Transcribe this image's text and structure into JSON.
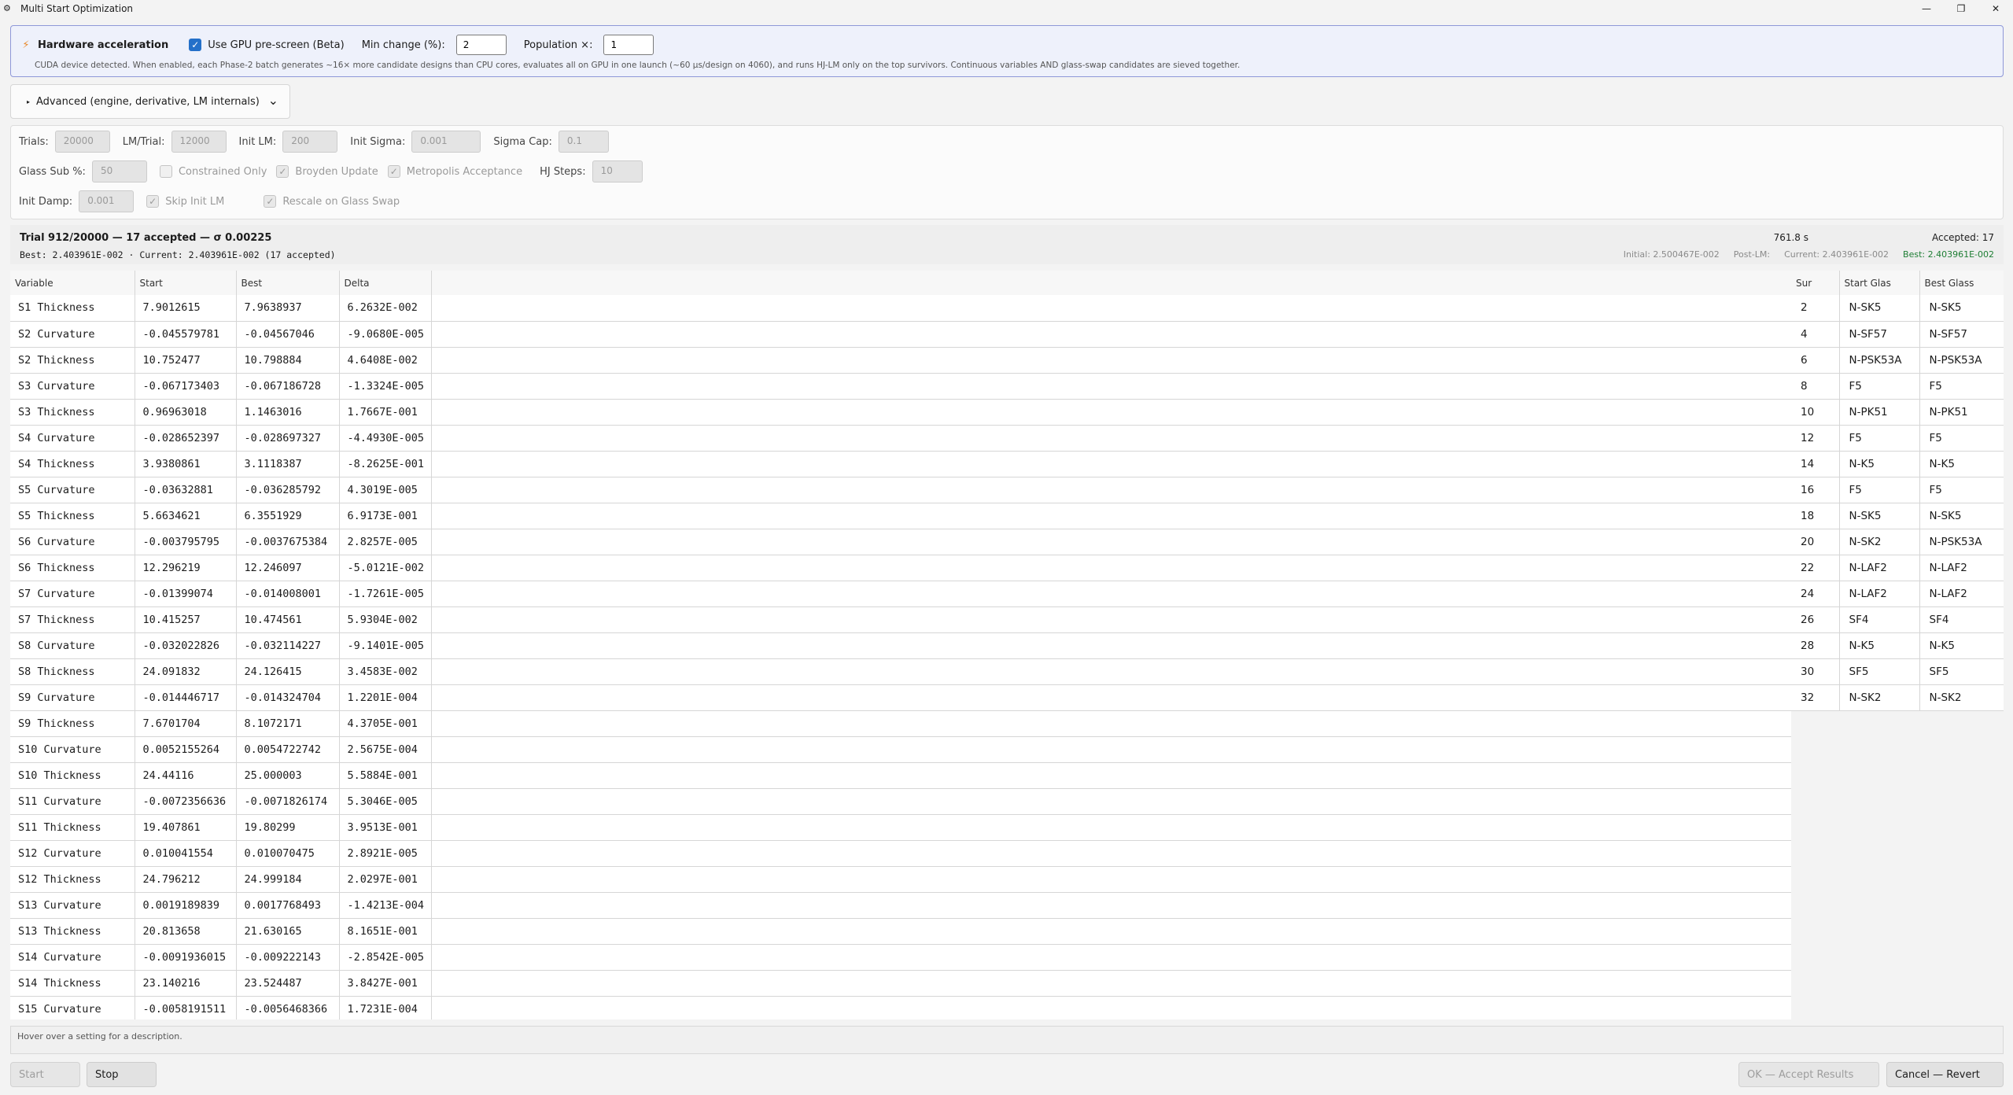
{
  "window": {
    "title": "Multi Start Optimization",
    "controls": [
      "—",
      "❐",
      "✕"
    ]
  },
  "hardware": {
    "title": "Hardware acceleration",
    "gpu_label": "Use GPU pre-screen (Beta)",
    "gpu_checked": true,
    "min_change_label": "Min change (%):",
    "min_change_value": "2",
    "population_label": "Population ×:",
    "population_value": "1",
    "note": "CUDA device detected. When enabled, each Phase-2 batch generates ~16× more candidate designs than CPU cores, evaluates all on GPU in one launch (~60 µs/design on 4060), and runs HJ-LM only on the top survivors. Continuous variables AND glass-swap candidates are sieved together."
  },
  "advanced": {
    "toggle_label": "Advanced (engine, derivative, LM internals)",
    "trials_label": "Trials:",
    "trials": "20000",
    "lm_trial_label": "LM/Trial:",
    "lm_trial": "12000",
    "init_lm_label": "Init LM:",
    "init_lm": "200",
    "init_sigma_label": "Init Sigma:",
    "init_sigma": "0.001",
    "sigma_cap_label": "Sigma Cap:",
    "sigma_cap": "0.1",
    "glass_sub_label": "Glass Sub %:",
    "glass_sub": "50",
    "constrained_only": "Constrained Only",
    "broyden_update": "Broyden Update",
    "metropolis": "Metropolis Acceptance",
    "hj_steps_label": "HJ Steps:",
    "hj_steps": "10",
    "init_damp_label": "Init Damp:",
    "init_damp": "0.001",
    "skip_init_lm": "Skip Init LM",
    "rescale_glass_swap": "Rescale on Glass Swap"
  },
  "status": {
    "title": "Trial 912/20000 — 17 accepted — σ 0.00225",
    "subtitle": "Best: 2.403961E-002  ·  Current: 2.403961E-002  (17 accepted)",
    "time": "761.8 s",
    "accepted": "Accepted: 17",
    "initial": "Initial: 2.500467E-002",
    "post_lm": "Post-LM:",
    "current": "Current: 2.403961E-002",
    "best": "Best: 2.403961E-002"
  },
  "variables": {
    "headers": [
      "Variable",
      "Start",
      "Best",
      "Delta"
    ],
    "rows": [
      [
        "S1 Thickness",
        "7.9012615",
        "7.9638937",
        "6.2632E-002"
      ],
      [
        "S2 Curvature",
        "-0.045579781",
        "-0.04567046",
        "-9.0680E-005"
      ],
      [
        "S2 Thickness",
        "10.752477",
        "10.798884",
        "4.6408E-002"
      ],
      [
        "S3 Curvature",
        "-0.067173403",
        "-0.067186728",
        "-1.3324E-005"
      ],
      [
        "S3 Thickness",
        "0.96963018",
        "1.1463016",
        "1.7667E-001"
      ],
      [
        "S4 Curvature",
        "-0.028652397",
        "-0.028697327",
        "-4.4930E-005"
      ],
      [
        "S4 Thickness",
        "3.9380861",
        "3.1118387",
        "-8.2625E-001"
      ],
      [
        "S5 Curvature",
        "-0.03632881",
        "-0.036285792",
        "4.3019E-005"
      ],
      [
        "S5 Thickness",
        "5.6634621",
        "6.3551929",
        "6.9173E-001"
      ],
      [
        "S6 Curvature",
        "-0.003795795",
        "-0.0037675384",
        "2.8257E-005"
      ],
      [
        "S6 Thickness",
        "12.296219",
        "12.246097",
        "-5.0121E-002"
      ],
      [
        "S7 Curvature",
        "-0.01399074",
        "-0.014008001",
        "-1.7261E-005"
      ],
      [
        "S7 Thickness",
        "10.415257",
        "10.474561",
        "5.9304E-002"
      ],
      [
        "S8 Curvature",
        "-0.032022826",
        "-0.032114227",
        "-9.1401E-005"
      ],
      [
        "S8 Thickness",
        "24.091832",
        "24.126415",
        "3.4583E-002"
      ],
      [
        "S9 Curvature",
        "-0.014446717",
        "-0.014324704",
        "1.2201E-004"
      ],
      [
        "S9 Thickness",
        "7.6701704",
        "8.1072171",
        "4.3705E-001"
      ],
      [
        "S10 Curvature",
        "0.0052155264",
        "0.0054722742",
        "2.5675E-004"
      ],
      [
        "S10 Thickness",
        "24.44116",
        "25.000003",
        "5.5884E-001"
      ],
      [
        "S11 Curvature",
        "-0.0072356636",
        "-0.0071826174",
        "5.3046E-005"
      ],
      [
        "S11 Thickness",
        "19.407861",
        "19.80299",
        "3.9513E-001"
      ],
      [
        "S12 Curvature",
        "0.010041554",
        "0.010070475",
        "2.8921E-005"
      ],
      [
        "S12 Thickness",
        "24.796212",
        "24.999184",
        "2.0297E-001"
      ],
      [
        "S13 Curvature",
        "0.0019189839",
        "0.0017768493",
        "-1.4213E-004"
      ],
      [
        "S13 Thickness",
        "20.813658",
        "21.630165",
        "8.1651E-001"
      ],
      [
        "S14 Curvature",
        "-0.0091936015",
        "-0.009222143",
        "-2.8542E-005"
      ],
      [
        "S14 Thickness",
        "23.140216",
        "23.524487",
        "3.8427E-001"
      ],
      [
        "S15 Curvature",
        "-0.0058191511",
        "-0.0056468366",
        "1.7231E-004"
      ]
    ]
  },
  "glasses": {
    "headers": [
      "Sur",
      "Start Glas",
      "Best Glass"
    ],
    "rows": [
      [
        "2",
        "N-SK5",
        "N-SK5"
      ],
      [
        "4",
        "N-SF57",
        "N-SF57"
      ],
      [
        "6",
        "N-PSK53A",
        "N-PSK53A"
      ],
      [
        "8",
        "F5",
        "F5"
      ],
      [
        "10",
        "N-PK51",
        "N-PK51"
      ],
      [
        "12",
        "F5",
        "F5"
      ],
      [
        "14",
        "N-K5",
        "N-K5"
      ],
      [
        "16",
        "F5",
        "F5"
      ],
      [
        "18",
        "N-SK5",
        "N-SK5"
      ],
      [
        "20",
        "N-SK2",
        "N-PSK53A"
      ],
      [
        "22",
        "N-LAF2",
        "N-LAF2"
      ],
      [
        "24",
        "N-LAF2",
        "N-LAF2"
      ],
      [
        "26",
        "SF4",
        "SF4"
      ],
      [
        "28",
        "N-K5",
        "N-K5"
      ],
      [
        "30",
        "SF5",
        "SF5"
      ],
      [
        "32",
        "N-SK2",
        "N-SK2"
      ]
    ]
  },
  "description": "Hover over a setting for a description.",
  "buttons": {
    "start": "Start",
    "stop": "Stop",
    "accept": "OK — Accept Results",
    "cancel": "Cancel — Revert"
  }
}
